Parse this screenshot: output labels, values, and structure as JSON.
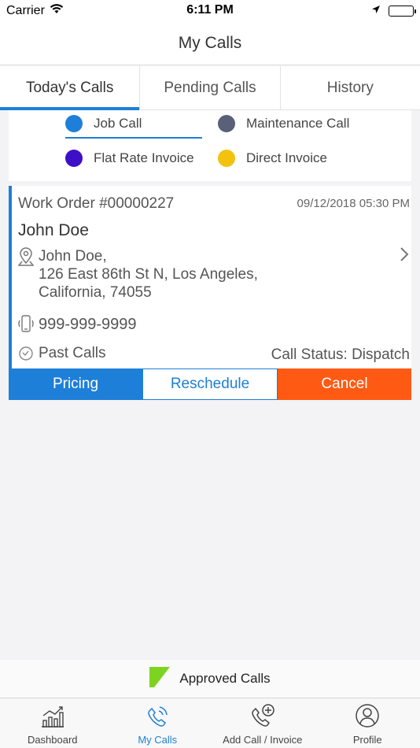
{
  "status_bar": {
    "carrier": "Carrier",
    "time": "6:11 PM"
  },
  "nav": {
    "title": "My Calls"
  },
  "tabs": [
    {
      "label": "Today's Calls",
      "active": true
    },
    {
      "label": "Pending Calls",
      "active": false
    },
    {
      "label": "History",
      "active": false
    }
  ],
  "legend": [
    {
      "label": "Job Call",
      "color": "#1e7fd8"
    },
    {
      "label": "Maintenance Call",
      "color": "#5a5f7a"
    },
    {
      "label": "Flat Rate Invoice",
      "color": "#3d10c8"
    },
    {
      "label": "Direct Invoice",
      "color": "#f2c20f"
    }
  ],
  "card": {
    "work_order": "Work Order #00000227",
    "datetime": "09/12/2018  05:30 PM",
    "customer": "John Doe",
    "address_line1": "John Doe,",
    "address_line2": "126 East 86th St N, Los Angeles,",
    "address_line3": "California, 74055",
    "phone": "999-999-9999",
    "past_calls": "Past Calls",
    "call_status": "Call Status: Dispatch",
    "accent_color": "#1e7fd8",
    "actions": {
      "pricing": "Pricing",
      "reschedule": "Reschedule",
      "cancel": "Cancel"
    }
  },
  "approved": {
    "label": "Approved Calls",
    "color": "#7ed321"
  },
  "tabbar": [
    {
      "label": "Dashboard",
      "icon": "dashboard-icon",
      "active": false
    },
    {
      "label": "My Calls",
      "icon": "phone-ringing-icon",
      "active": true
    },
    {
      "label": "Add Call / Invoice",
      "icon": "add-call-icon",
      "active": false
    },
    {
      "label": "Profile",
      "icon": "profile-icon",
      "active": false
    }
  ]
}
